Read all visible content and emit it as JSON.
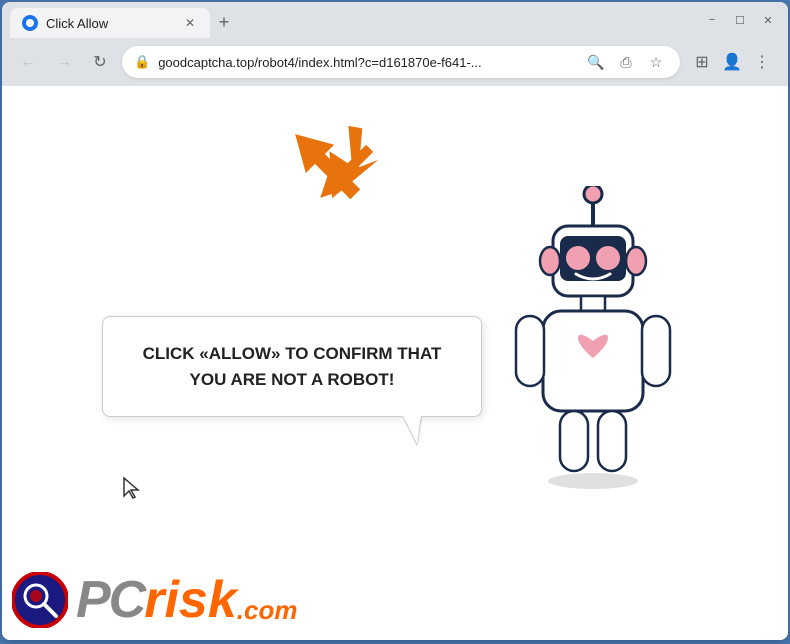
{
  "browser": {
    "tab": {
      "title": "Click Allow",
      "favicon": "globe-icon"
    },
    "new_tab_label": "+",
    "window_controls": {
      "minimize": "−",
      "maximize": "☐",
      "close": "✕"
    },
    "address_bar": {
      "url": "goodcaptcha.top/robot4/index.html?c=d161870e-f641-...",
      "lock_icon": "🔒"
    },
    "nav": {
      "back": "←",
      "forward": "→",
      "reload": "↻"
    }
  },
  "page": {
    "bubble_text": "CLICK «ALLOW» TO CONFIRM THAT YOU ARE NOT A ROBOT!",
    "arrow_color": "#e8720c",
    "cursor": "↖"
  },
  "logo": {
    "pc": "PC",
    "risk": "risk",
    "com": ".com"
  }
}
